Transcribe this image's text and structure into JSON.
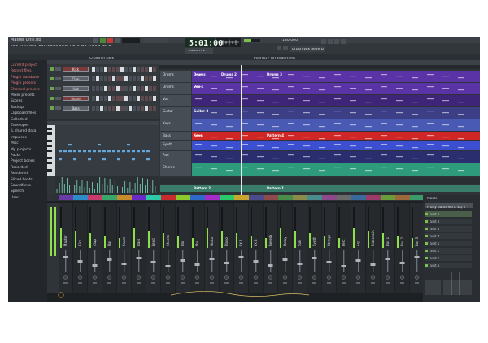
{
  "window": {
    "title": "Master Chill.flp"
  },
  "menu": [
    "FILE",
    "EDIT",
    "ADD",
    "PATTERNS",
    "VIEW",
    "OPTIONS",
    "TOOLS",
    "HELP"
  ],
  "transport": {
    "time": "5:01:00",
    "tempo": "130.000",
    "preset": "Crush Vox Reverb"
  },
  "pattern_selector": "Pattern 1",
  "channel_rack": {
    "title": "Channel rack"
  },
  "playlist": {
    "title": "Playlist - Arrangement"
  },
  "browser": {
    "items": [
      "Current project",
      "Recent files",
      "Plugin database",
      "Plugin presets",
      "Channel presets",
      "Mixer presets",
      "Scores",
      "Backup",
      "Clipboard files",
      "Collected",
      "Envelopes",
      "IL shared data",
      "Impulses",
      "Misc",
      "My projects",
      "Packs",
      "Project bones",
      "Recorded",
      "Rendered",
      "Sliced beats",
      "Soundfonts",
      "Speech",
      "User"
    ]
  },
  "channels": [
    "Kick",
    "Clap",
    "Hat",
    "Snare",
    "Bass"
  ],
  "tracks": [
    "Drums",
    "Drums",
    "Vox",
    "Guitar",
    "Keys",
    "Bass",
    "Synth",
    "Pad",
    "Chords"
  ],
  "clips": [
    "Drums",
    "Drums 2",
    "Drums 3",
    "Vox 1",
    "Guitar 3",
    "Keys",
    "Pattern 4",
    "Pattern 2",
    "Pattern 1"
  ],
  "mixer": {
    "tracks": [
      "Master",
      "Kick",
      "Clap",
      "Hat",
      "Snare",
      "Bass",
      "Lead",
      "Chords",
      "Pad",
      "Vox",
      "Guitar",
      "Piano",
      "FX 1",
      "FX 2",
      "Reverb",
      "Delay",
      "Sub",
      "Synth",
      "Strings",
      "Perc",
      "Arp",
      "Sidechain",
      "Bus 1",
      "Bus 2",
      "Bus 3"
    ],
    "selected": "Master",
    "slots": [
      "Slot 1",
      "Slot 2",
      "Slot 3",
      "Slot 4",
      "Slot 5",
      "Slot 6",
      "Slot 7",
      "Slot 8"
    ],
    "inserted": "Fruity parametric EQ 2"
  },
  "colors": {
    "purple": "#5a34a6",
    "purple_dark": "#3e2578",
    "red": "#d02626",
    "blue": "#3c4fd0",
    "teal": "#2d9b7c",
    "green_meter": "#8ee04a",
    "accent": "#f2c33b"
  }
}
